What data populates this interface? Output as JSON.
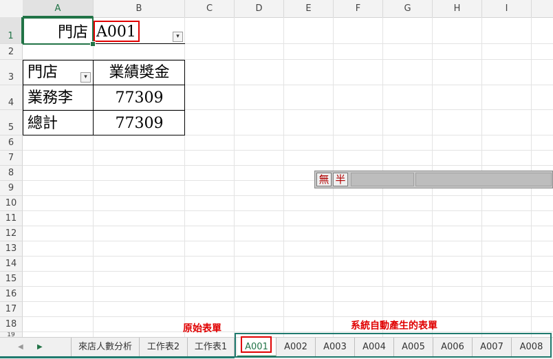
{
  "columns": [
    "A",
    "B",
    "C",
    "D",
    "E",
    "F",
    "G",
    "H",
    "I"
  ],
  "rows": [
    "1",
    "2",
    "3",
    "4",
    "5",
    "6",
    "7",
    "8",
    "9",
    "10",
    "11",
    "12",
    "13",
    "14",
    "15",
    "16",
    "17",
    "18",
    "19"
  ],
  "filter": {
    "label": "門店",
    "value": "A001"
  },
  "pivot": {
    "header_store": "門店",
    "header_bonus": "業績獎金",
    "rows": [
      {
        "store": "業務李",
        "bonus": "77309"
      },
      {
        "store": "總計",
        "bonus": "77309"
      }
    ]
  },
  "ime": {
    "btn1": "無",
    "btn2": "半"
  },
  "annotations": {
    "original": "原始表單",
    "generated": "系統自動產生的表單"
  },
  "nav": {
    "prev": "◀",
    "next": "▶"
  },
  "tabs": [
    "來店人數分析",
    "工作表2",
    "工作表1",
    "A001",
    "A002",
    "A003",
    "A004",
    "A005",
    "A006",
    "A007",
    "A008"
  ],
  "colors": {
    "accent": "#217346",
    "highlight": "#e00000",
    "teal": "#1f7a6e"
  }
}
